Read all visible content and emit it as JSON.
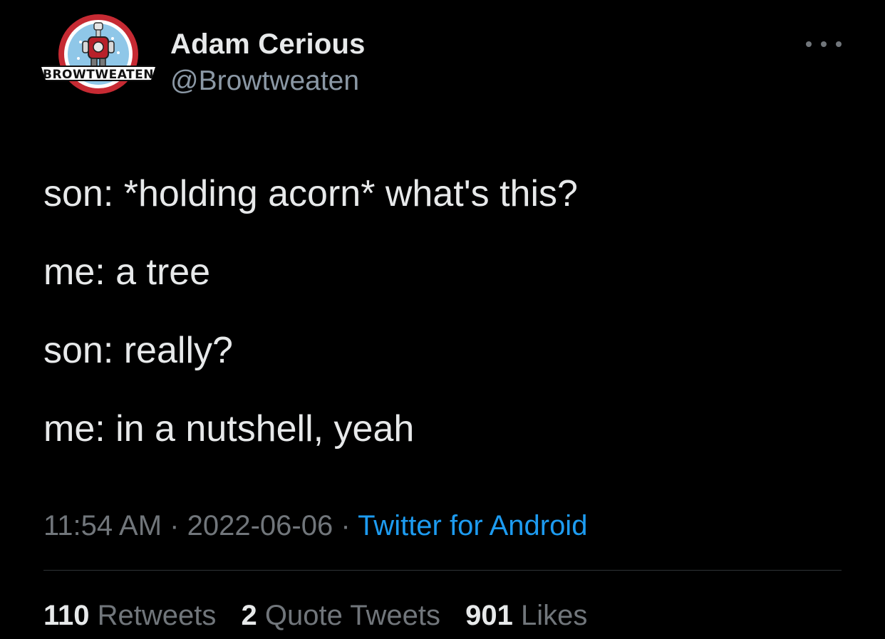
{
  "author": {
    "display_name": "Adam Cerious",
    "handle": "@Browtweaten",
    "avatar_text": "BROWTWEATEN",
    "avatar_icon": "browtweaten-logo"
  },
  "tweet": {
    "lines": [
      "son: *holding acorn* what's this?",
      "me: a tree",
      "son: really?",
      "me: in a nutshell, yeah"
    ],
    "time": "11:54 AM",
    "date": "2022-06-06",
    "separator": "·",
    "source": "Twitter for Android"
  },
  "stats": {
    "retweets_count": "110",
    "retweets_label": "Retweets",
    "quotes_count": "2",
    "quotes_label": "Quote Tweets",
    "likes_count": "901",
    "likes_label": "Likes"
  },
  "icons": {
    "more": "more-horizontal-icon"
  },
  "colors": {
    "background": "#000000",
    "text": "#e7e9ea",
    "secondary": "#71767b",
    "link": "#1d9bf0",
    "divider": "#2f3336"
  }
}
